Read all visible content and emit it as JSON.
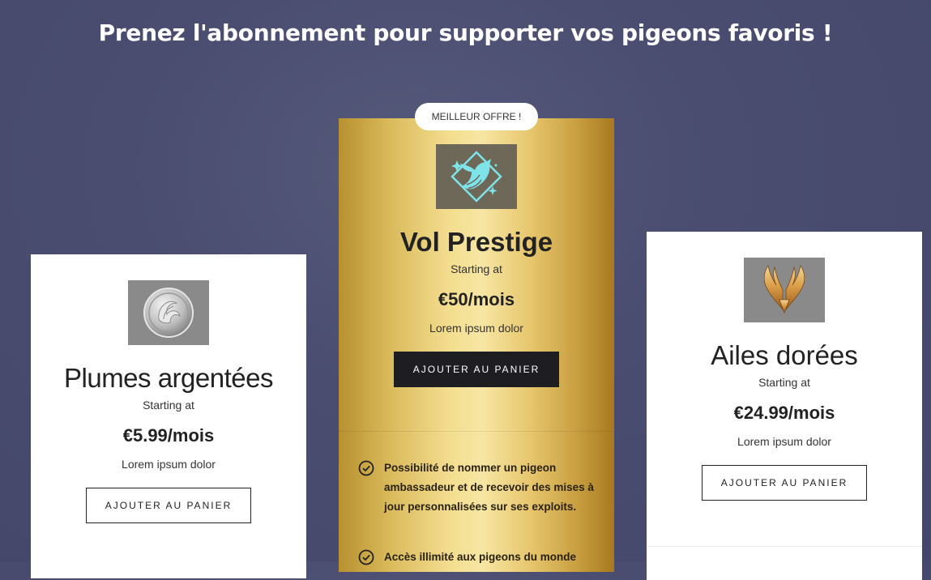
{
  "page": {
    "title": "Prenez l'abonnement pour supporter vos pigeons favoris !"
  },
  "badge": {
    "label": "MEILLEUR OFFRE !"
  },
  "plans": [
    {
      "name": "Plumes argentées",
      "starting": "Starting at",
      "price": "€5.99/mois",
      "description": "Lorem ipsum dolor",
      "button_label": "AJOUTER AU PANIER",
      "icon": "silver-feather-emblem-icon"
    },
    {
      "name": "Vol Prestige",
      "starting": "Starting at",
      "price": "€50/mois",
      "description": "Lorem ipsum dolor",
      "button_label": "AJOUTER AU PANIER",
      "icon": "dove-diamond-icon",
      "features": [
        "Possibilité de nommer un pigeon ambassadeur et de recevoir des mises à jour personnalisées sur ses exploits.",
        "Accès illimité aux pigeons du monde"
      ]
    },
    {
      "name": "Ailes dorées",
      "starting": "Starting at",
      "price": "€24.99/mois",
      "description": "Lorem ipsum dolor",
      "button_label": "AJOUTER AU PANIER",
      "icon": "golden-wings-icon"
    }
  ],
  "colors": {
    "background": "#4a4d70",
    "gold": "#e6c56c",
    "dark_button": "#1d1d22",
    "icon_cyan": "#7fe3ea"
  }
}
